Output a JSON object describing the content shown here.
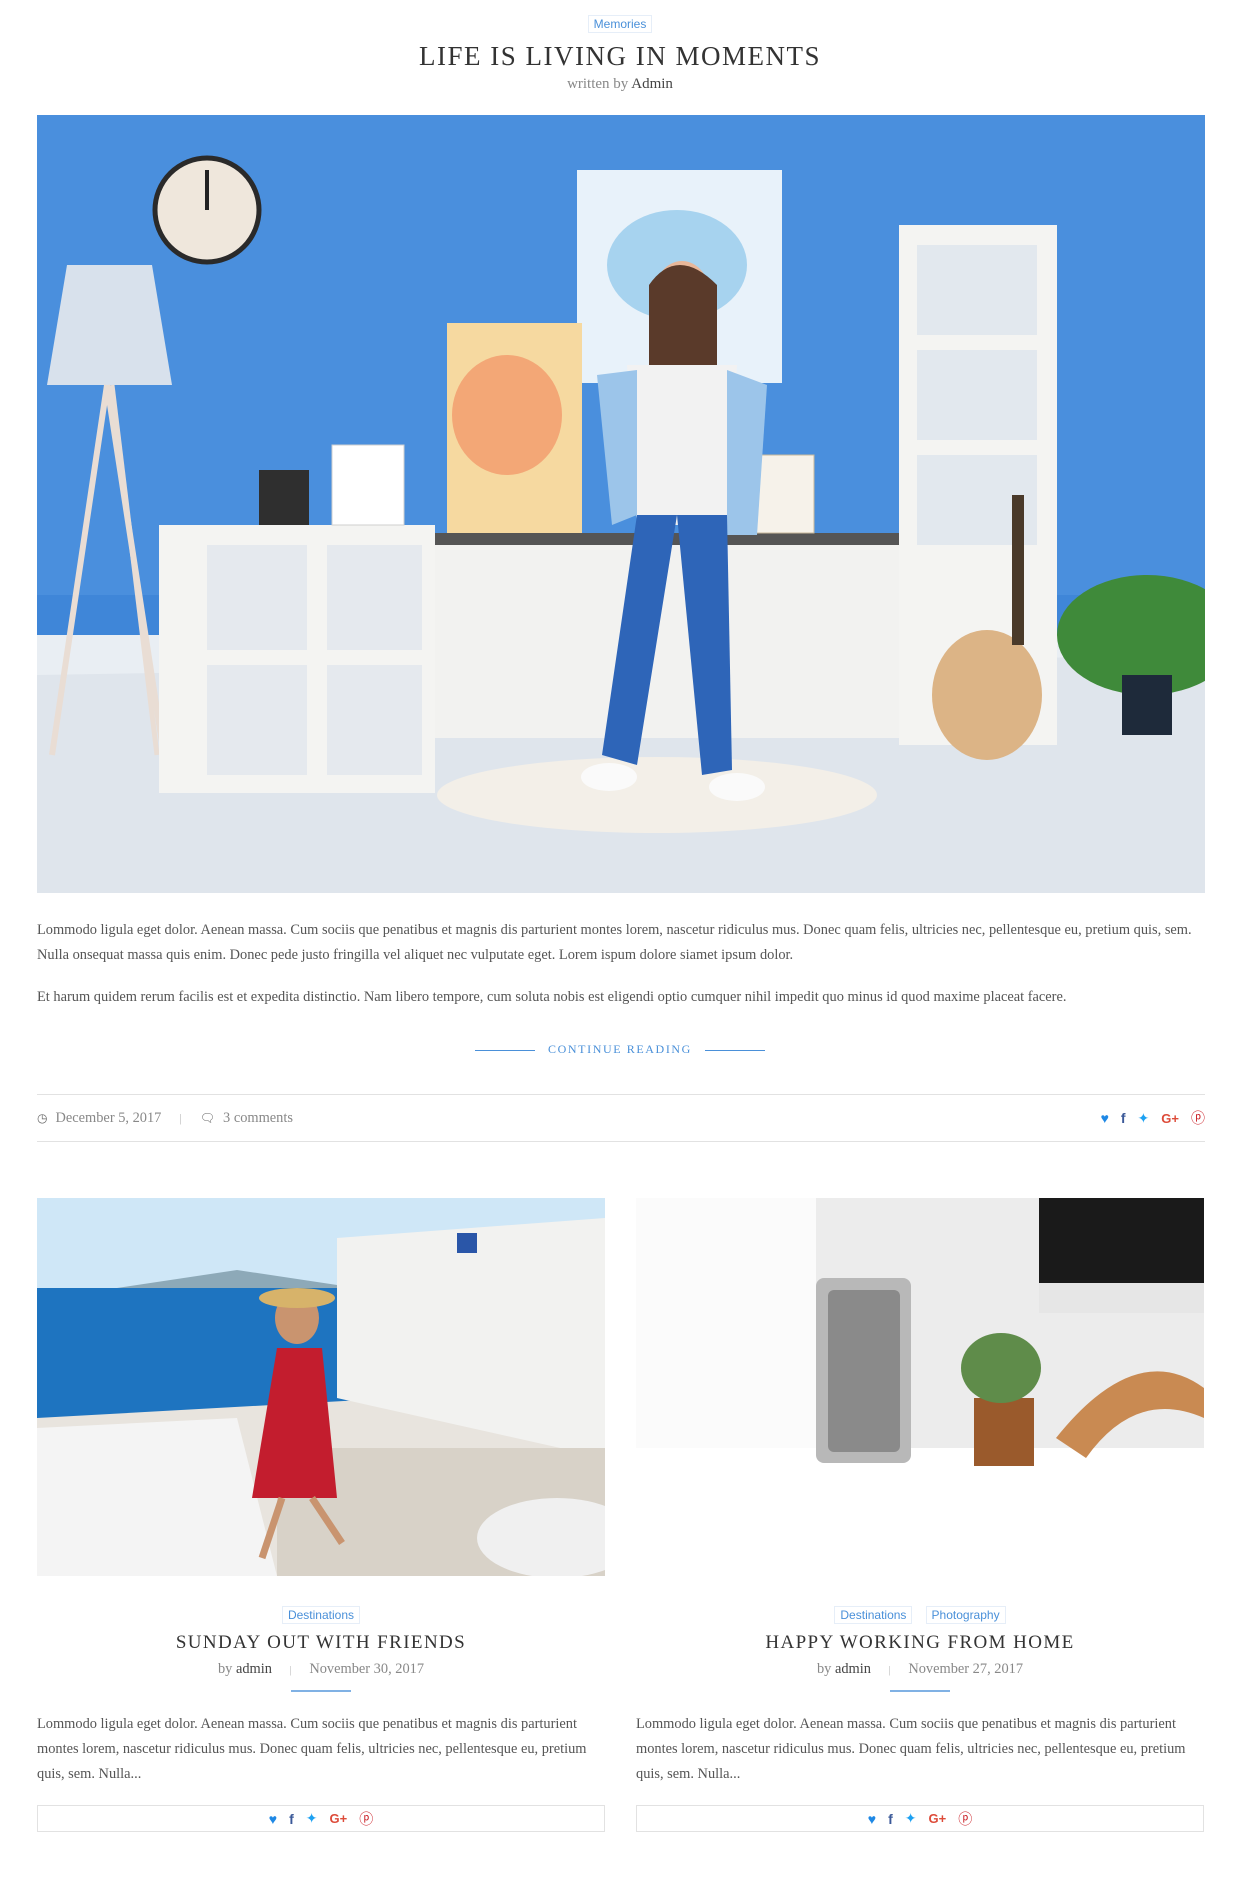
{
  "featured": {
    "category": "Memories",
    "title": "LIFE IS LIVING IN MOMENTS",
    "byline_prefix": "written by",
    "author": "Admin",
    "paragraph1": "Lommodo ligula eget dolor. Aenean massa. Cum sociis que penatibus et magnis dis parturient montes lorem, nascetur ridiculus mus. Donec quam felis, ultricies nec, pellentesque eu, pretium quis, sem. Nulla onsequat massa quis enim. Donec pede justo fringilla vel aliquet nec vulputate eget. Lorem ispum dolore siamet ipsum dolor.",
    "paragraph2": "Et harum quidem rerum facilis est et expedita distinctio. Nam libero tempore, cum soluta nobis est eligendi optio cumquer nihil impedit quo minus id quod maxime placeat facere.",
    "continue_label": "CONTINUE READING",
    "date": "December 5, 2017",
    "comments": "3 comments"
  },
  "share_icons": {
    "heart": "♥",
    "facebook": "f",
    "twitter": "🐦",
    "google_plus": "G+",
    "pinterest": "℗"
  },
  "colors": {
    "accent": "#4a90d9",
    "heart": "#1e88e5",
    "facebook": "#3b5998",
    "twitter": "#1da1f2",
    "google_plus": "#dd4b39",
    "pinterest": "#cb2027"
  },
  "posts": [
    {
      "categories": [
        "Destinations"
      ],
      "title": "SUNDAY OUT WITH FRIENDS",
      "by_prefix": "by",
      "author": "admin",
      "date": "November 30, 2017",
      "excerpt": "Lommodo ligula eget dolor. Aenean massa. Cum sociis que penatibus et magnis dis parturient montes lorem, nascetur ridiculus mus. Donec quam felis, ultricies nec, pellentesque eu, pretium quis, sem. Nulla..."
    },
    {
      "categories": [
        "Destinations",
        "Photography"
      ],
      "title": "HAPPY WORKING FROM HOME",
      "by_prefix": "by",
      "author": "admin",
      "date": "November 27, 2017",
      "excerpt": "Lommodo ligula eget dolor. Aenean massa. Cum sociis que penatibus et magnis dis parturient montes lorem, nascetur ridiculus mus. Donec quam felis, ultricies nec, pellentesque eu, pretium quis, sem. Nulla..."
    }
  ]
}
